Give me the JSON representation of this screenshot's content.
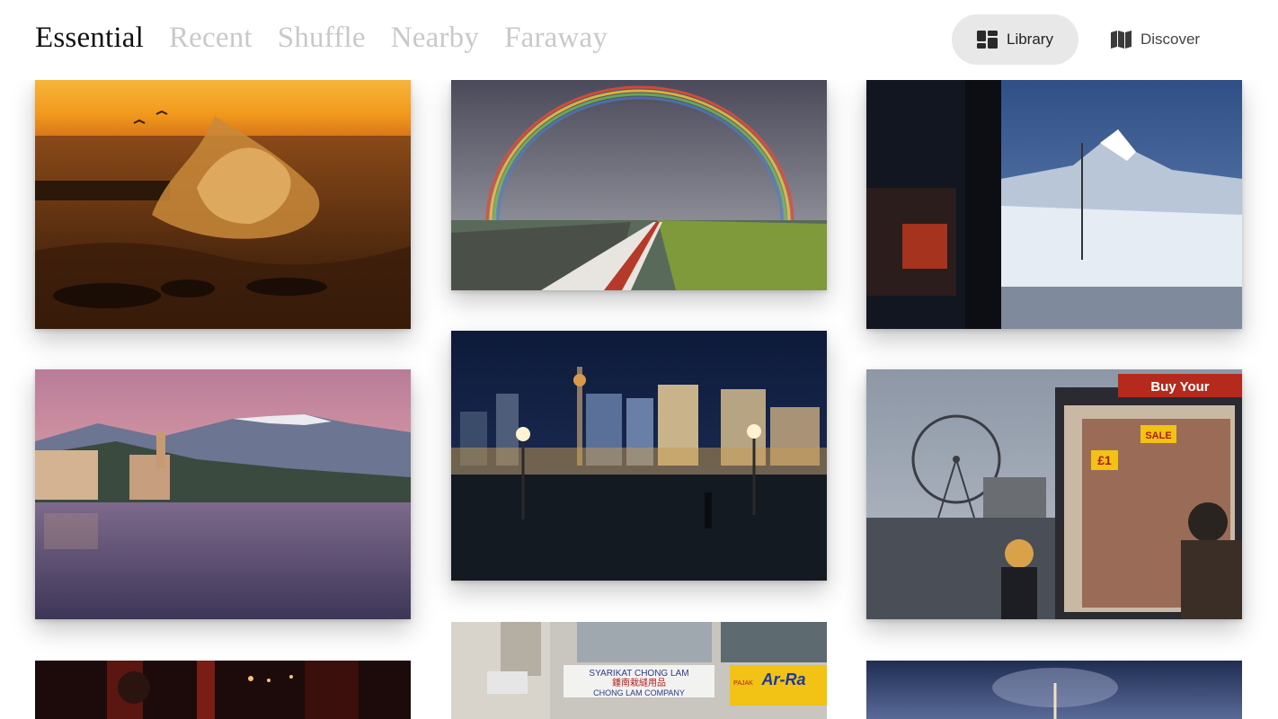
{
  "tabs": [
    {
      "label": "Essential",
      "active": true
    },
    {
      "label": "Recent",
      "active": false
    },
    {
      "label": "Shuffle",
      "active": false
    },
    {
      "label": "Nearby",
      "active": false
    },
    {
      "label": "Faraway",
      "active": false
    }
  ],
  "nav": {
    "library": {
      "label": "Library",
      "icon": "library-grid-icon",
      "active": true
    },
    "discover": {
      "label": "Discover",
      "icon": "map-icon",
      "active": false
    }
  },
  "photos": {
    "sunset_wave": {
      "subject": "ocean wave at sunset"
    },
    "rainbow_train": {
      "subject": "rainbow over train tracks"
    },
    "mountain_train": {
      "subject": "snowy mountain peak through train window"
    },
    "lake_town": {
      "subject": "lakeside town at dusk with mountains"
    },
    "city_bridge": {
      "subject": "city skyline at night from bridge"
    },
    "london_eye": {
      "subject": "ferris wheel and souvenir stall"
    },
    "neon_bar": {
      "subject": "dim red interior"
    },
    "shop_front": {
      "sign_1": "SYARIKAT CHONG LAM",
      "sign_2": "鍾南栽縫用品",
      "sign_3": "CHONG LAM COMPANY",
      "sign_4": "Ar-Ra",
      "sign_5": "PAJAK"
    },
    "night_tower": {
      "subject": "tower at night"
    }
  },
  "stall_signs": {
    "sale": "SALE",
    "price": "£1",
    "banner": "Buy Your"
  },
  "colors": {
    "active_tab": "#111111",
    "inactive_tab": "#c9c9c9",
    "active_pill": "#e8e8e8"
  }
}
